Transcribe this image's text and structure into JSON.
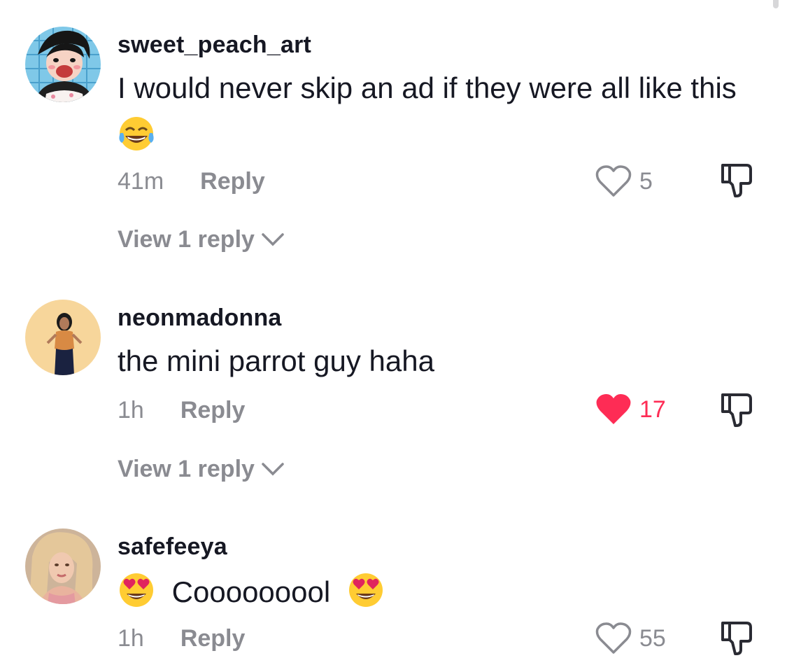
{
  "colors": {
    "accent_like": "#fe2c55",
    "muted": "#8a8b91",
    "text": "#161823"
  },
  "comments": [
    {
      "username": "sweet_peach_art",
      "text": "I would never skip an ad if they were all like this",
      "emoji": "face-with-tears-of-joy",
      "time": "41m",
      "reply_label": "Reply",
      "like_count": "5",
      "liked": false,
      "view_replies": "View 1 reply"
    },
    {
      "username": "neonmadonna",
      "text": "the mini parrot guy haha",
      "time": "1h",
      "reply_label": "Reply",
      "like_count": "17",
      "liked": true,
      "view_replies": "View 1 reply"
    },
    {
      "username": "safefeeya",
      "text": "Cooooooool",
      "emoji": "smiling-face-with-heart-eyes",
      "time": "1h",
      "reply_label": "Reply",
      "like_count": "55",
      "liked": false
    }
  ]
}
